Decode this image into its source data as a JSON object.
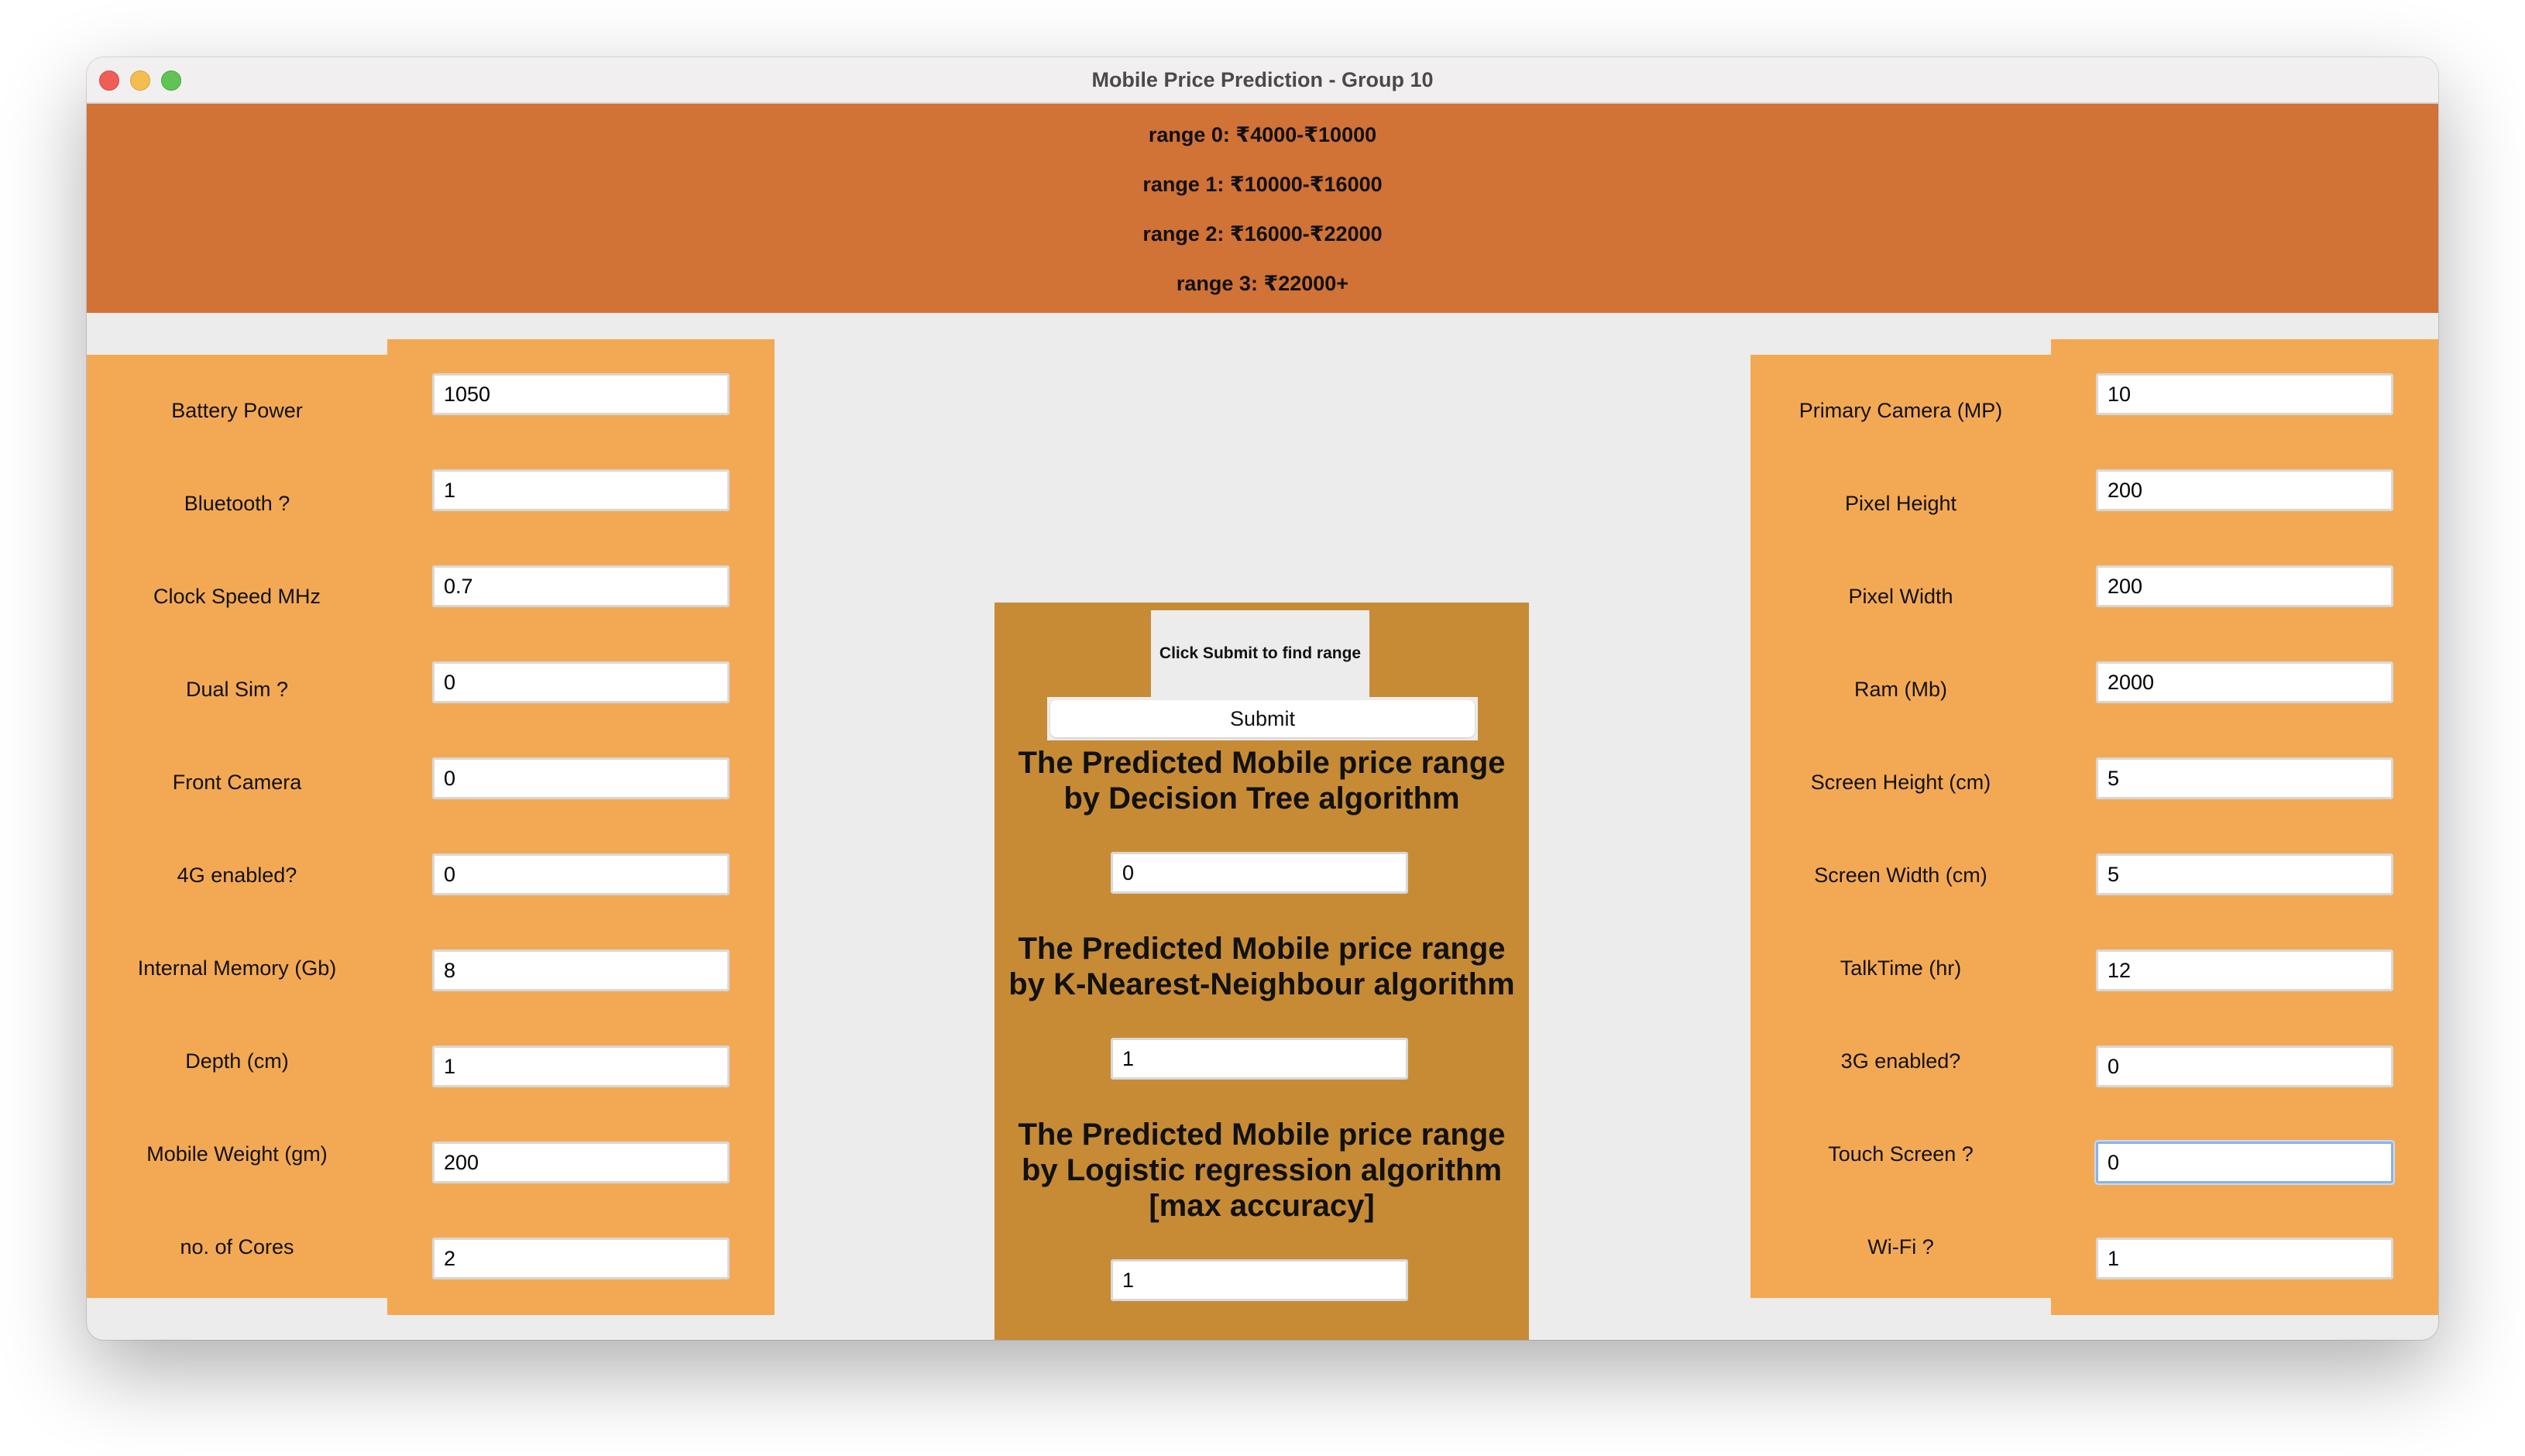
{
  "window": {
    "title": "Mobile Price Prediction - Group 10"
  },
  "banner": {
    "ranges": [
      "range 0: ₹4000-₹10000",
      "range 1: ₹10000-₹16000",
      "range 2: ₹16000-₹22000",
      "range 3: ₹22000+"
    ]
  },
  "left_fields": [
    {
      "label": "Battery Power",
      "value": "1050"
    },
    {
      "label": "Bluetooth ?",
      "value": "1"
    },
    {
      "label": "Clock Speed MHz",
      "value": "0.7"
    },
    {
      "label": "Dual Sim ?",
      "value": "0"
    },
    {
      "label": "Front Camera",
      "value": "0"
    },
    {
      "label": "4G enabled?",
      "value": "0"
    },
    {
      "label": "Internal Memory (Gb)",
      "value": "8"
    },
    {
      "label": "Depth (cm)",
      "value": "1"
    },
    {
      "label": "Mobile Weight (gm)",
      "value": "200"
    },
    {
      "label": "no. of Cores",
      "value": "2"
    }
  ],
  "right_fields": [
    {
      "label": "Primary Camera (MP)",
      "value": "10"
    },
    {
      "label": "Pixel Height",
      "value": "200"
    },
    {
      "label": "Pixel Width",
      "value": "200"
    },
    {
      "label": "Ram (Mb)",
      "value": "2000"
    },
    {
      "label": "Screen Height (cm)",
      "value": "5"
    },
    {
      "label": "Screen Width (cm)",
      "value": "5"
    },
    {
      "label": "TalkTime (hr)",
      "value": "12"
    },
    {
      "label": "3G enabled?",
      "value": "0"
    },
    {
      "label": "Touch Screen ?",
      "value": "0"
    },
    {
      "label": "Wi-Fi ?",
      "value": "1"
    }
  ],
  "center": {
    "status": "Click Submit to find range",
    "submit_label": "Submit",
    "predictions": [
      {
        "title_lines": [
          "The Predicted Mobile price range",
          "by Decision Tree algorithm"
        ],
        "value": "0"
      },
      {
        "title_lines": [
          "The Predicted Mobile price range",
          "by K-Nearest-Neighbour algorithm"
        ],
        "value": "1"
      },
      {
        "title_lines": [
          "The Predicted Mobile price range",
          "by Logistic regression algorithm",
          "[max accuracy]"
        ],
        "value": "1"
      }
    ]
  },
  "colors": {
    "banner": "#d17237",
    "side_panel": "#f3a954",
    "center_panel": "#c78b36",
    "window_bg": "#ececec"
  }
}
